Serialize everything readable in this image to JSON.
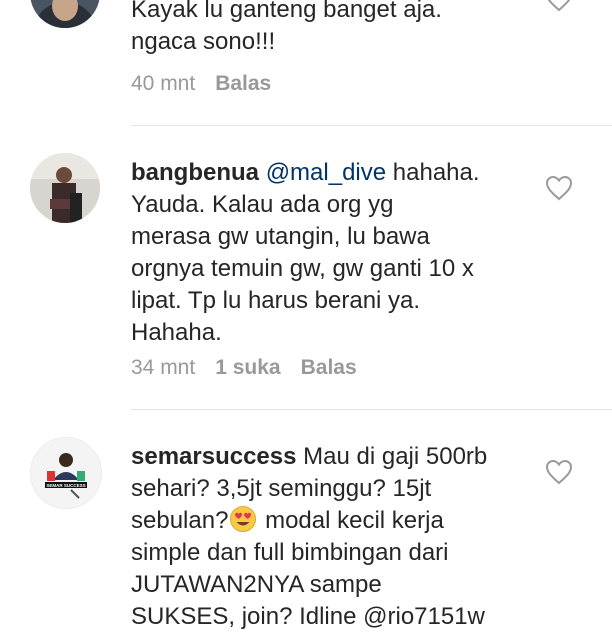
{
  "comments": [
    {
      "username": "",
      "lines": [
        "Kayak lu ganteng banget aja.",
        "ngaca sono!!!"
      ],
      "time": "40 mnt",
      "likes": "",
      "reply": "Balas"
    },
    {
      "username": "bangbenua",
      "mention": "@mal_dive",
      "line1_rest": " hahaha.",
      "lines": [
        "Yauda. Kalau ada org yg",
        "merasa gw utangin, lu bawa",
        "orgnya temuin gw, gw ganti 10 x",
        "lipat. Tp lu harus berani ya.",
        "Hahaha."
      ],
      "time": "34 mnt",
      "likes": "1 suka",
      "reply": "Balas"
    },
    {
      "username": "semarsuccess",
      "line1_rest": " Mau di gaji 500rb",
      "lines": [
        "sehari? 3,5jt seminggu? 15jt"
      ],
      "line3": "sebulan?",
      "line3_rest": " modal kecil kerja",
      "lines_after": [
        "simple dan full bimbingan dari",
        "JUTAWAN2NYA sampe",
        "SUKSES, join? Idline @rio7151w"
      ],
      "avatar_caption": "SEMAR SUCCESS"
    }
  ],
  "icons": {
    "heart": "heart-outline-icon",
    "emoji": "smiling-face-with-heart-eyes-emoji"
  },
  "colors": {
    "text": "#262626",
    "meta": "#999999",
    "mention": "#003569",
    "divider": "#e3e3e3"
  }
}
